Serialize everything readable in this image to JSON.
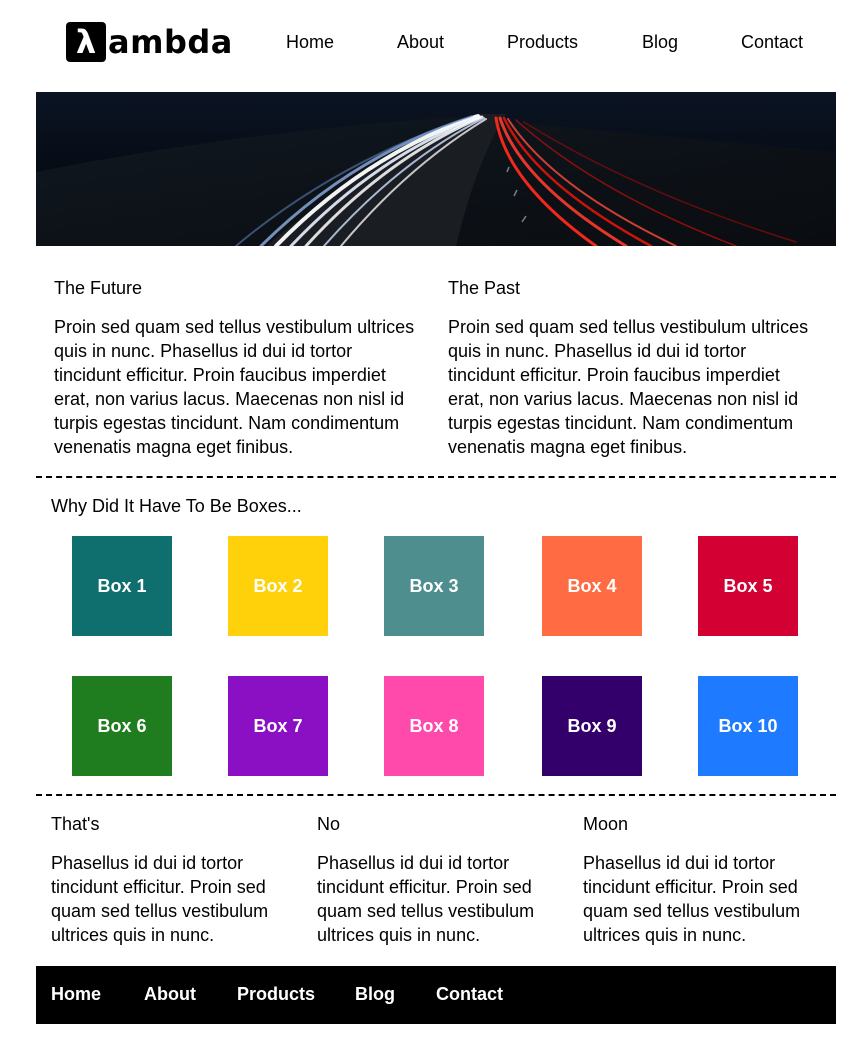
{
  "brand": {
    "logo_mark": "λ",
    "logo_text": "ambda"
  },
  "nav": {
    "items": [
      "Home",
      "About",
      "Products",
      "Blog",
      "Contact"
    ]
  },
  "hero": {
    "image": "night-highway-light-trails"
  },
  "top_columns": [
    {
      "title": "The Future",
      "body": "Proin sed quam sed tellus vestibulum ultrices quis in nunc. Phasellus id dui id tortor tincidunt efficitur. Proin faucibus imperdiet erat, non varius lacus. Maecenas non nisl id turpis egestas tincidunt. Nam condimentum venenatis magna eget finibus."
    },
    {
      "title": "The Past",
      "body": "Proin sed quam sed tellus vestibulum ultrices quis in nunc. Phasellus id dui id tortor tincidunt efficitur. Proin faucibus imperdiet erat, non varius lacus. Maecenas non nisl id turpis egestas tincidunt. Nam condimentum venenatis magna eget finibus."
    }
  ],
  "boxes_section": {
    "title": "Why Did It Have To Be Boxes...",
    "boxes": [
      {
        "label": "Box 1",
        "color": "#0f6e6e"
      },
      {
        "label": "Box 2",
        "color": "#ffd10a"
      },
      {
        "label": "Box 3",
        "color": "#4e8e8e"
      },
      {
        "label": "Box 4",
        "color": "#ff6b42"
      },
      {
        "label": "Box 5",
        "color": "#d20033"
      },
      {
        "label": "Box 6",
        "color": "#1f7d1f"
      },
      {
        "label": "Box 7",
        "color": "#8b10c4"
      },
      {
        "label": "Box 8",
        "color": "#ff4aab"
      },
      {
        "label": "Box 9",
        "color": "#33006b"
      },
      {
        "label": "Box 10",
        "color": "#1e7bff"
      }
    ]
  },
  "bottom_columns": [
    {
      "title": "That's",
      "body": "Phasellus id dui id tortor tincidunt efficitur. Proin sed quam sed tellus vestibulum ultrices quis in nunc."
    },
    {
      "title": "No",
      "body": "Phasellus id dui id tortor tincidunt efficitur. Proin sed quam sed tellus vestibulum ultrices quis in nunc."
    },
    {
      "title": "Moon",
      "body": "Phasellus id dui id tortor tincidunt efficitur. Proin sed quam sed tellus vestibulum ultrices quis in nunc."
    }
  ],
  "footer_nav": {
    "items": [
      "Home",
      "About",
      "Products",
      "Blog",
      "Contact"
    ]
  }
}
